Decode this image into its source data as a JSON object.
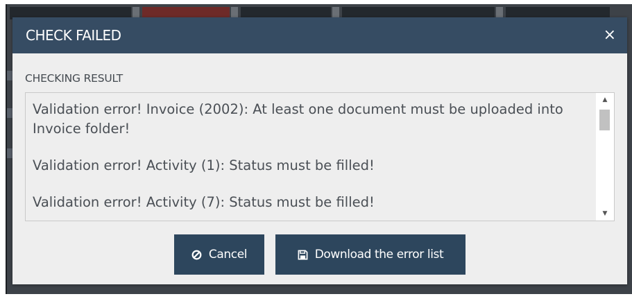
{
  "modal": {
    "title": "CHECK FAILED",
    "close_label": "×",
    "section_label": "CHECKING RESULT",
    "messages": [
      "Validation error! Invoice (2002): At least one document must be uploaded into Invoice folder!",
      "Validation error! Activity (1): Status must be filled!",
      "Validation error! Activity (7): Status must be filled!"
    ],
    "scroll": {
      "up_icon": "▲",
      "down_icon": "▼"
    }
  },
  "buttons": {
    "cancel": {
      "label": "Cancel",
      "icon": "ban-icon"
    },
    "download": {
      "label": "Download the error list",
      "icon": "save-icon"
    }
  },
  "colors": {
    "header": "#364c63",
    "button": "#2d465d",
    "modal_bg": "#eeeeee"
  }
}
